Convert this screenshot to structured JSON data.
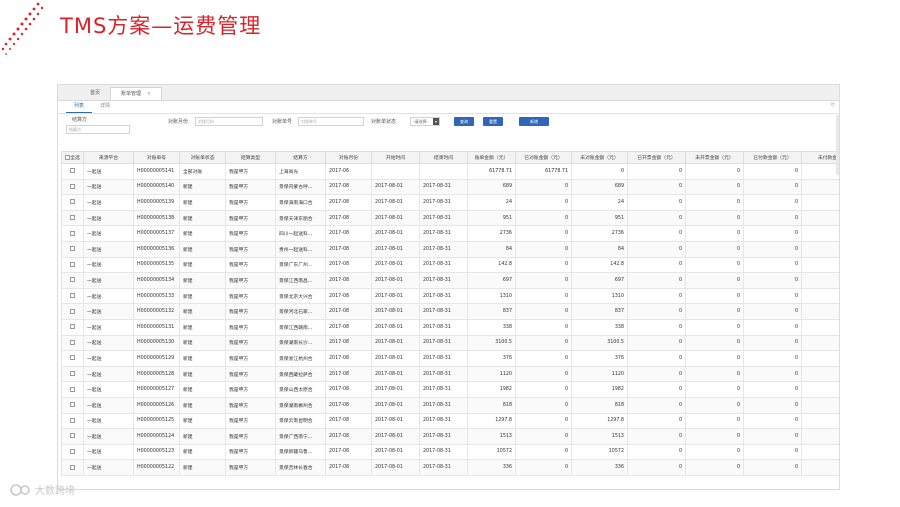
{
  "slide": {
    "title": "TMS方案—运费管理"
  },
  "brand": {
    "logo_text": "大数跨境"
  },
  "tabs": [
    {
      "label": "首页"
    },
    {
      "label": "账单管理",
      "close": "×"
    }
  ],
  "subtabs": [
    {
      "label": "列表"
    },
    {
      "label": "详情"
    }
  ],
  "filters": {
    "carrier_label": "结算方",
    "carrier_placeholder": "结算方",
    "month_label": "对账月份",
    "month_placeholder": "对账月份",
    "bill_no_label": "对账单号",
    "bill_no_placeholder": "对账单号",
    "status_label": "对账单状态",
    "status_value": "-请选择-",
    "buttons": {
      "search": "查询",
      "reset": "重置",
      "new": "新增"
    }
  },
  "table": {
    "headers": [
      "全选",
      "来源平台",
      "对账单号",
      "对账单状态",
      "结算类型",
      "结算方",
      "对账月份",
      "开始时间",
      "结束时间",
      "账单金额（元）",
      "已对账金额（元）",
      "未对账金额（元）",
      "已开票金额（元）",
      "未开票金额（元）",
      "已付款金额（元）",
      "未付款金"
    ],
    "rows": [
      [
        "一起送",
        "H00000005141",
        "全部对账",
        "我是甲方",
        "上海尚光",
        "2017-06",
        "",
        "",
        "61778.71",
        "61778.71",
        "0",
        "0",
        "0",
        "0",
        ""
      ],
      [
        "一起送",
        "H00000005140",
        "新建",
        "我是甲方",
        "景保内蒙古呼...",
        "2017-08",
        "2017-08-01",
        "2017-08-31",
        "689",
        "0",
        "689",
        "0",
        "0",
        "0",
        ""
      ],
      [
        "一起送",
        "H00000005139",
        "新建",
        "我是甲方",
        "景保海南海口合",
        "2017-08",
        "2017-08-01",
        "2017-08-31",
        "24",
        "0",
        "24",
        "0",
        "0",
        "0",
        ""
      ],
      [
        "一起送",
        "H00000005138",
        "新建",
        "我是甲方",
        "景保天津东丽合",
        "2017-08",
        "2017-08-01",
        "2017-08-31",
        "951",
        "0",
        "951",
        "0",
        "0",
        "0",
        ""
      ],
      [
        "一起送",
        "H00000005137",
        "新建",
        "我是甲方",
        "四川一起送科...",
        "2017-08",
        "2017-08-01",
        "2017-08-31",
        "2736",
        "0",
        "2736",
        "0",
        "0",
        "0",
        ""
      ],
      [
        "一起送",
        "H00000005136",
        "新建",
        "我是甲方",
        "贵州一起送科...",
        "2017-08",
        "2017-08-01",
        "2017-08-31",
        "84",
        "0",
        "84",
        "0",
        "0",
        "0",
        ""
      ],
      [
        "一起送",
        "H00000005135",
        "新建",
        "我是甲方",
        "景保广东广州...",
        "2017-08",
        "2017-08-01",
        "2017-08-31",
        "142.8",
        "0",
        "142.8",
        "0",
        "0",
        "0",
        ""
      ],
      [
        "一起送",
        "H00000005134",
        "新建",
        "我是甲方",
        "景保江西南昌...",
        "2017-08",
        "2017-08-01",
        "2017-08-31",
        "697",
        "0",
        "697",
        "0",
        "0",
        "0",
        ""
      ],
      [
        "一起送",
        "H00000005133",
        "新建",
        "我是甲方",
        "景保北京大兴合",
        "2017-08",
        "2017-08-01",
        "2017-08-31",
        "1310",
        "0",
        "1310",
        "0",
        "0",
        "0",
        ""
      ],
      [
        "一起送",
        "H00000005132",
        "新建",
        "我是甲方",
        "景保河北石家...",
        "2017-08",
        "2017-08-01",
        "2017-08-31",
        "837",
        "0",
        "837",
        "0",
        "0",
        "0",
        ""
      ],
      [
        "一起送",
        "H00000005131",
        "新建",
        "我是甲方",
        "景保江西赣南...",
        "2017-08",
        "2017-08-01",
        "2017-08-31",
        "338",
        "0",
        "338",
        "0",
        "0",
        "0",
        ""
      ],
      [
        "一起送",
        "H00000005130",
        "新建",
        "我是甲方",
        "景保湖南长沙...",
        "2017-08",
        "2017-08-01",
        "2017-08-31",
        "3100.5",
        "0",
        "3100.5",
        "0",
        "0",
        "0",
        ""
      ],
      [
        "一起送",
        "H00000005129",
        "新建",
        "我是甲方",
        "景保浙江杭州合",
        "2017-08",
        "2017-08-01",
        "2017-08-31",
        "376",
        "0",
        "376",
        "0",
        "0",
        "0",
        ""
      ],
      [
        "一起送",
        "H00000005128",
        "新建",
        "我是甲方",
        "景保西藏拉萨合",
        "2017-08",
        "2017-08-01",
        "2017-08-31",
        "1120",
        "0",
        "1120",
        "0",
        "0",
        "0",
        ""
      ],
      [
        "一起送",
        "H00000005127",
        "新建",
        "我是甲方",
        "景保山西太原合",
        "2017-08",
        "2017-08-01",
        "2017-08-31",
        "1982",
        "0",
        "1982",
        "0",
        "0",
        "0",
        ""
      ],
      [
        "一起送",
        "H00000005126",
        "新建",
        "我是甲方",
        "景保湖南郴州合",
        "2017-08",
        "2017-08-01",
        "2017-08-31",
        "818",
        "0",
        "818",
        "0",
        "0",
        "0",
        ""
      ],
      [
        "一起送",
        "H00000005125",
        "新建",
        "我是甲方",
        "景保云南昆明合",
        "2017-08",
        "2017-08-01",
        "2017-08-31",
        "1297.8",
        "0",
        "1297.8",
        "0",
        "0",
        "0",
        ""
      ],
      [
        "一起送",
        "H00000005124",
        "新建",
        "我是甲方",
        "景保广西南宁...",
        "2017-08",
        "2017-08-01",
        "2017-08-31",
        "1513",
        "0",
        "1513",
        "0",
        "0",
        "0",
        ""
      ],
      [
        "一起送",
        "H00000005123",
        "新建",
        "我是甲方",
        "景保新疆乌鲁...",
        "2017-08",
        "2017-08-01",
        "2017-08-31",
        "10572",
        "0",
        "10572",
        "0",
        "0",
        "0",
        ""
      ],
      [
        "一起送",
        "H00000005122",
        "新建",
        "我是甲方",
        "景保吉林长春合",
        "2017-08",
        "2017-08-01",
        "2017-08-31",
        "336",
        "0",
        "336",
        "0",
        "0",
        "0",
        ""
      ]
    ]
  },
  "colors": {
    "title_red": "#d8232a",
    "button_blue": "#2f66b6"
  }
}
